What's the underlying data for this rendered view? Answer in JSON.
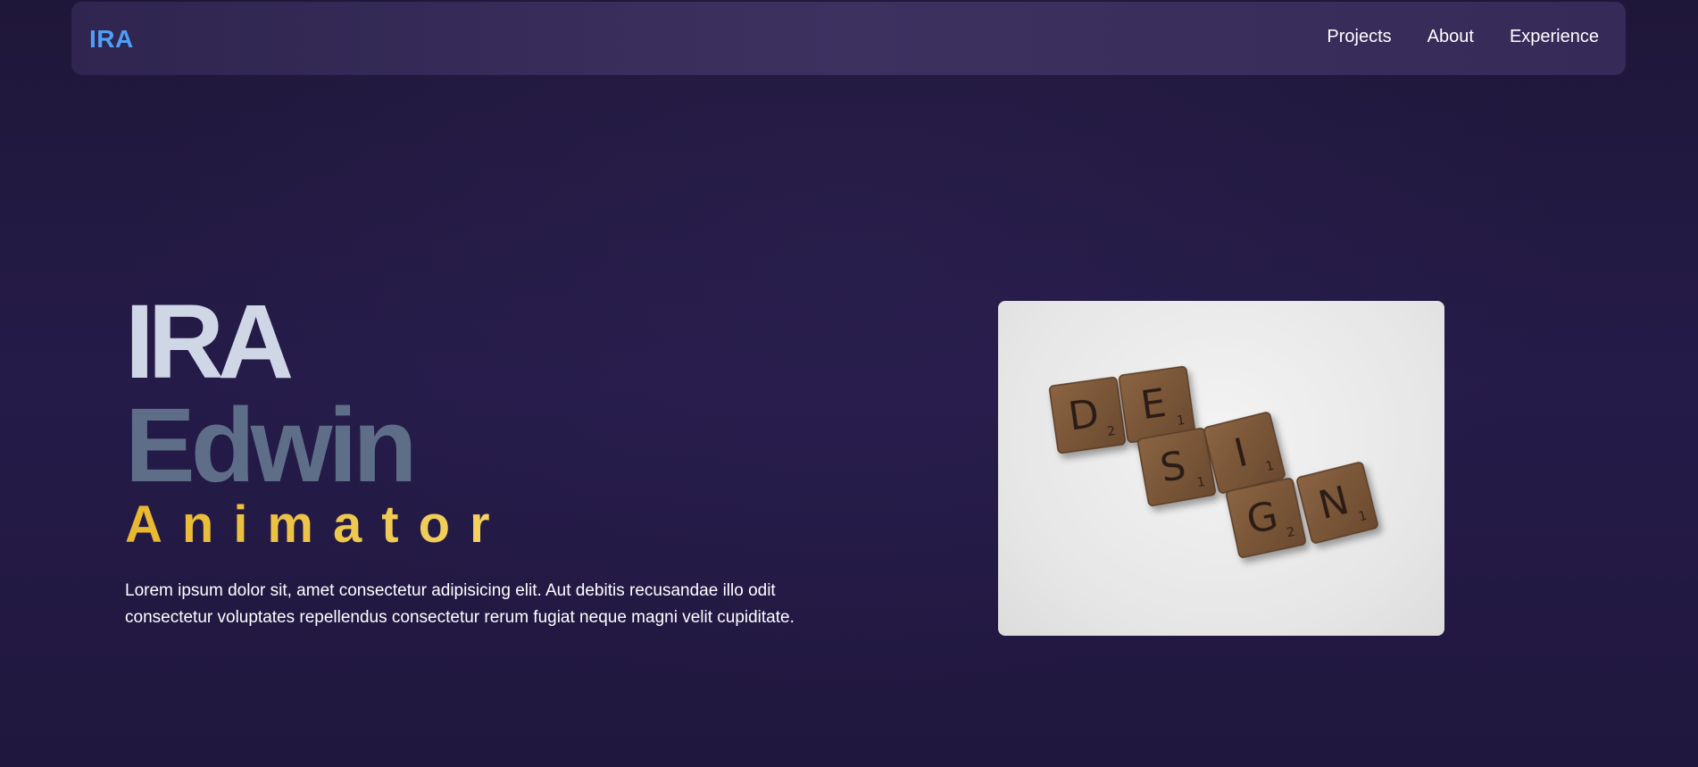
{
  "nav": {
    "logo": "IRA",
    "links": [
      "Projects",
      "About",
      "Experience"
    ]
  },
  "hero": {
    "first_name": "IRA",
    "last_name": "Edwin",
    "role": "Animator",
    "description": "Lorem ipsum dolor sit, amet consectetur adipisicing elit. Aut debitis recusandae illo odit consectetur voluptates repellendus consectetur rerum fugiat neque magni velit cupiditate."
  },
  "image": {
    "tiles": [
      {
        "letter": "D",
        "score": "2"
      },
      {
        "letter": "E",
        "score": "1"
      },
      {
        "letter": "S",
        "score": "1"
      },
      {
        "letter": "I",
        "score": "1"
      },
      {
        "letter": "G",
        "score": "2"
      },
      {
        "letter": "N",
        "score": "1"
      }
    ]
  },
  "colors": {
    "background": "#22193f",
    "navbar": "#3a2e5c",
    "logo": "#4f9ff7",
    "first_name": "#cfd7e6",
    "last_name": "#5f6e88",
    "role_gradient_start": "#e8b730",
    "role_gradient_end": "#f8e07a",
    "tile_wood": "#7a5638"
  }
}
